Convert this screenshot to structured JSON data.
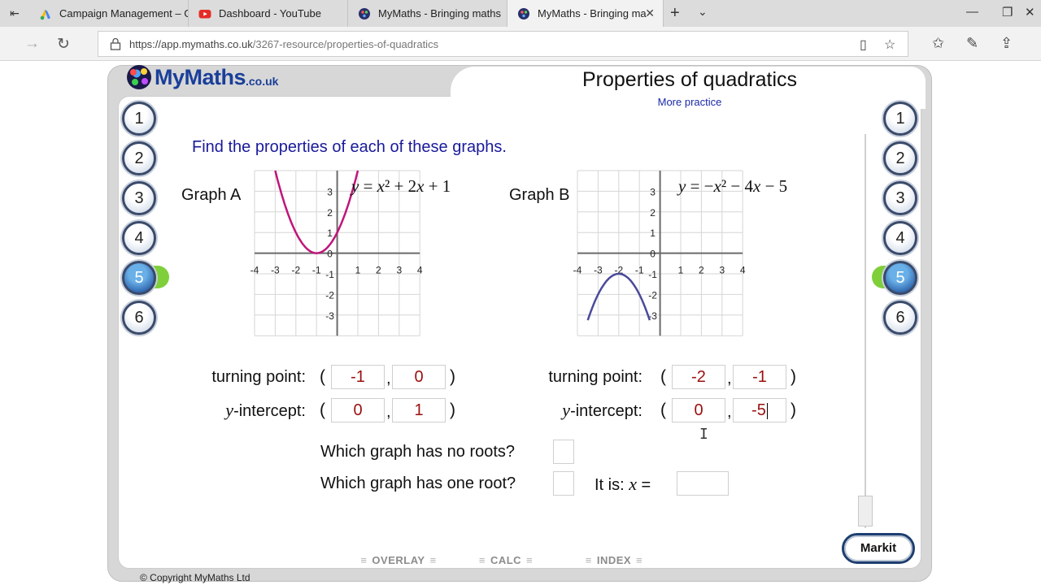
{
  "browser": {
    "tabs": [
      {
        "label": "Campaign Management – G",
        "icon": "google-ads-icon",
        "active": false
      },
      {
        "label": "Dashboard - YouTube",
        "icon": "youtube-icon",
        "active": false
      },
      {
        "label": "MyMaths - Bringing maths",
        "icon": "mymaths-icon",
        "active": false
      },
      {
        "label": "MyMaths - Bringing ma",
        "icon": "mymaths-icon",
        "active": true
      }
    ],
    "url_prefix": "https://app.mymaths.co.uk",
    "url_path": "/3267-resource/properties-of-quadratics"
  },
  "app": {
    "logo_text": "MyMaths",
    "logo_suffix": ".co.uk",
    "title": "Properties of quadratics",
    "subtitle": "More practice",
    "instruction": "Find the properties of each of these graphs.",
    "questions": [
      "1",
      "2",
      "3",
      "4",
      "5",
      "6"
    ],
    "active_question": "5",
    "graph_a": {
      "label": "Graph A",
      "eq_parts": [
        "y",
        " = ",
        "x",
        "² + 2",
        "x",
        " + 1"
      ],
      "x_ticks": [
        "-4",
        "-3",
        "-2",
        "-1",
        "1",
        "2",
        "3",
        "4"
      ],
      "y_ticks": [
        "3",
        "2",
        "1",
        "0",
        "-1",
        "-2",
        "-3"
      ],
      "curve_color": "#c0157a"
    },
    "graph_b": {
      "label": "Graph B",
      "eq_parts": [
        "y",
        " = −",
        "x",
        "² − 4",
        "x",
        " − 5"
      ],
      "x_ticks": [
        "-4",
        "-3",
        "-2",
        "-1",
        "1",
        "2",
        "3",
        "4"
      ],
      "y_ticks": [
        "3",
        "2",
        "1",
        "0",
        "-1",
        "-2",
        "-3"
      ],
      "curve_color": "#4a4a9a"
    },
    "labels": {
      "turning_point": "turning point:",
      "y_intercept_var": "y",
      "y_intercept_rest": "-intercept:",
      "open_paren": "(",
      "close_paren": ")",
      "comma": ","
    },
    "answers": {
      "a_tp_x": "-1",
      "a_tp_y": "0",
      "a_yi_x": "0",
      "a_yi_y": "1",
      "b_tp_x": "-2",
      "b_tp_y": "-1",
      "b_yi_x": "0",
      "b_yi_y": "-5"
    },
    "q_no_roots": "Which graph has no roots?",
    "q_one_root": "Which graph has one root?",
    "it_is_prefix": "It is: ",
    "it_is_var": "x",
    "it_is_suffix": " =",
    "markit": "Markit",
    "bottom_tabs": [
      "OVERLAY",
      "CALC",
      "INDEX"
    ],
    "copyright": "© Copyright MyMaths Ltd"
  }
}
